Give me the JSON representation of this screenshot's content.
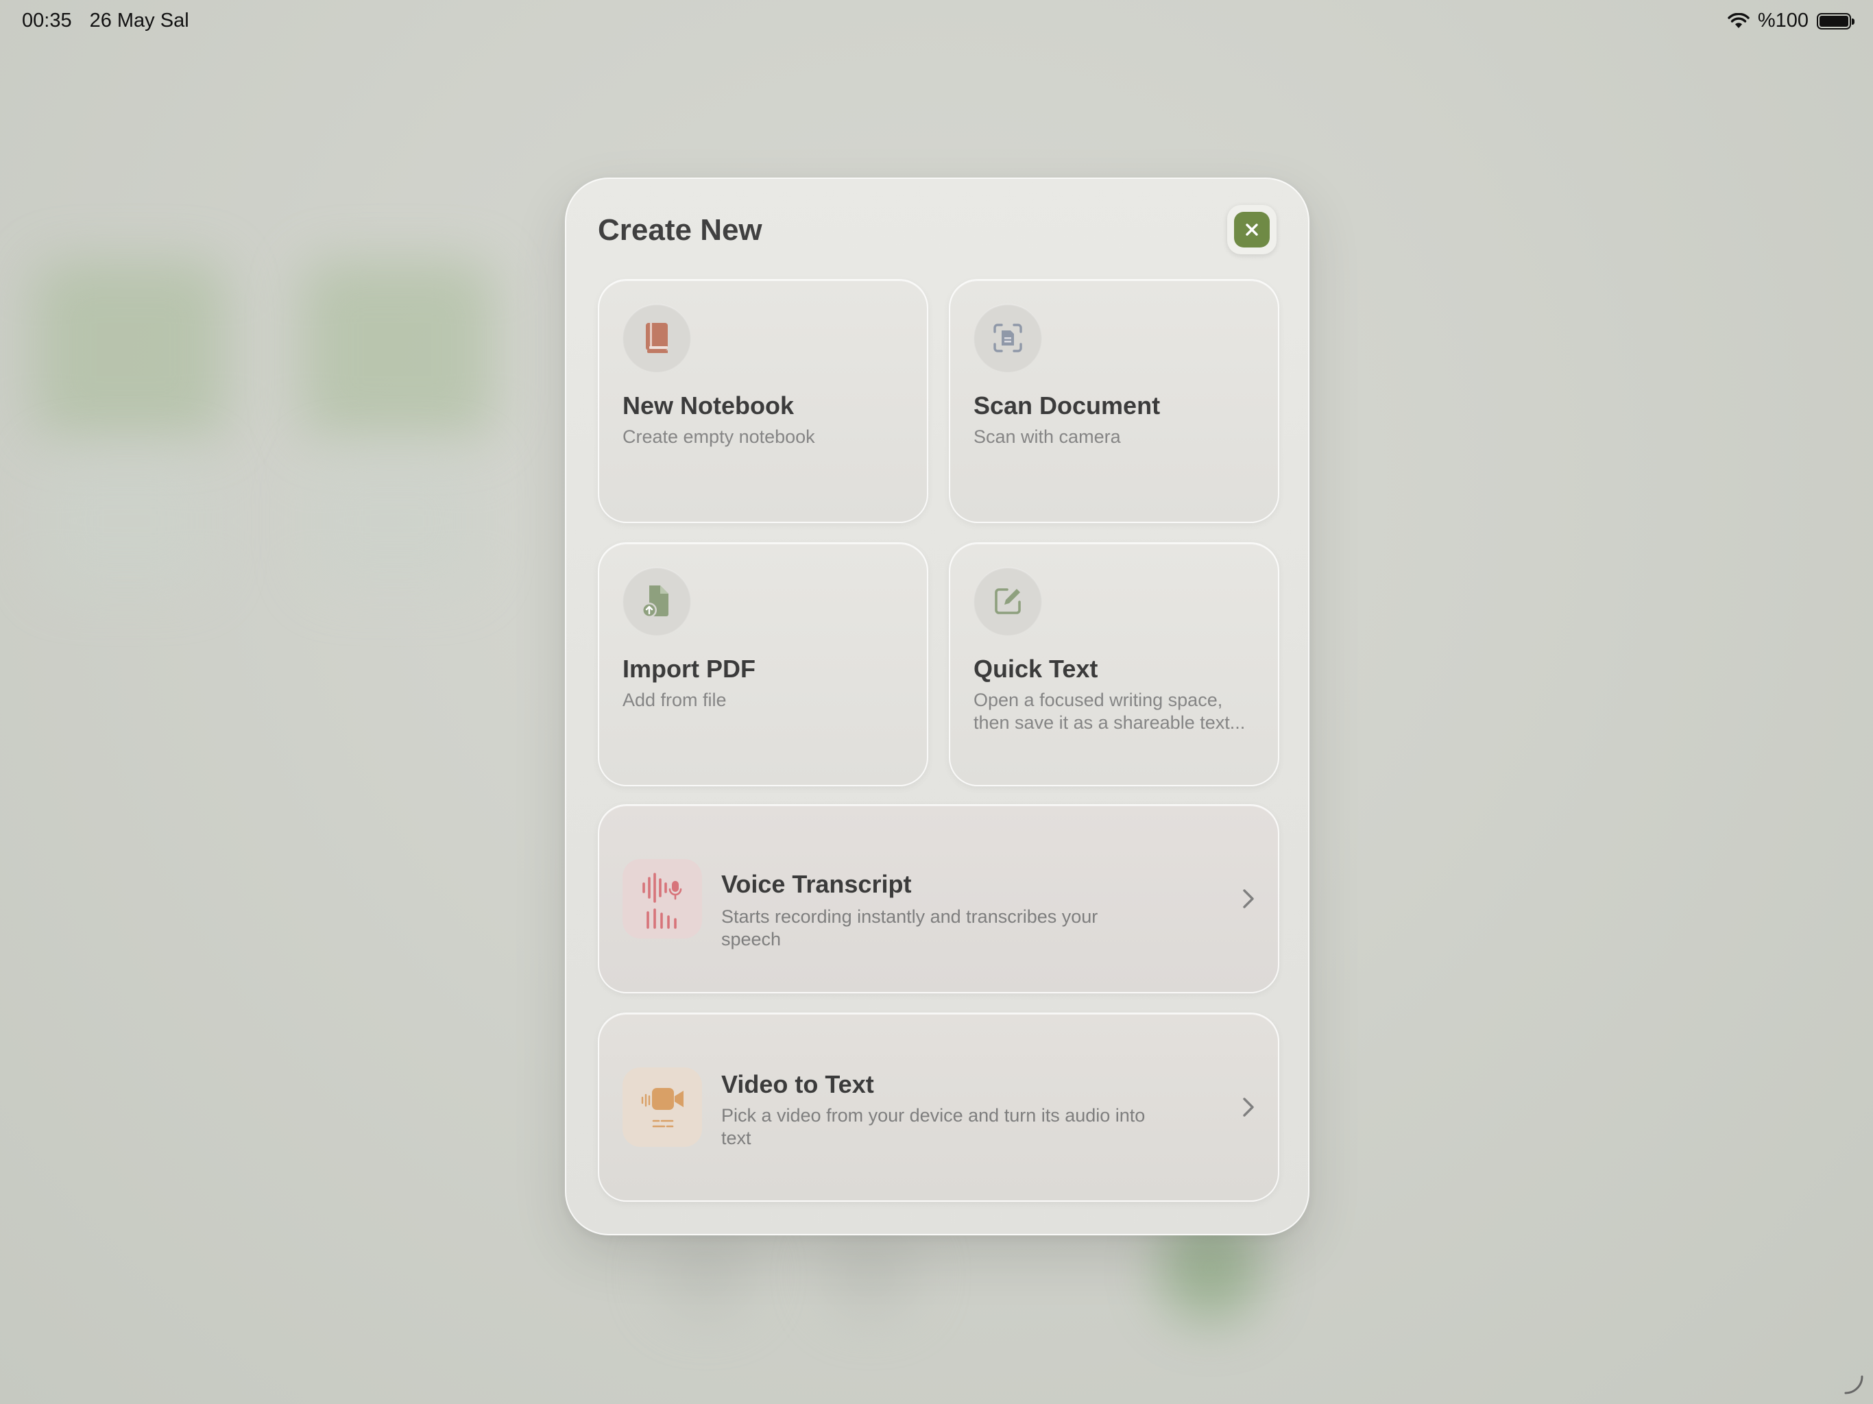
{
  "status_bar": {
    "time": "00:35",
    "date": "26 May Sal",
    "battery": "%100"
  },
  "modal": {
    "title": "Create New",
    "close_icon": "xmark-icon",
    "accent": "#6f8a45"
  },
  "cards": [
    {
      "title": "New Notebook",
      "subtitle": "Create empty notebook",
      "icon": "book-icon",
      "icon_color": "#c07a64"
    },
    {
      "title": "Scan Document",
      "subtitle": "Scan with camera",
      "icon": "doc-scanner-icon",
      "icon_color": "#8f98a8"
    },
    {
      "title": "Import PDF",
      "subtitle": "Add from file",
      "icon": "document-upload-icon",
      "icon_color": "#8ea07e"
    },
    {
      "title": "Quick Text",
      "subtitle": "Open a focused writing space, then save it as a shareable text...",
      "icon": "compose-icon",
      "icon_color": "#8ea07e"
    }
  ],
  "rows": [
    {
      "title": "Voice Transcript",
      "subtitle": "Starts recording instantly and transcribes your speech",
      "icon": "waveform-mic-icon",
      "icon_color": "#d7747a"
    },
    {
      "title": "Video to Text",
      "subtitle": "Pick a video from your device and turn its audio into text",
      "icon": "video-caption-icon",
      "icon_color": "#d9a066"
    }
  ]
}
